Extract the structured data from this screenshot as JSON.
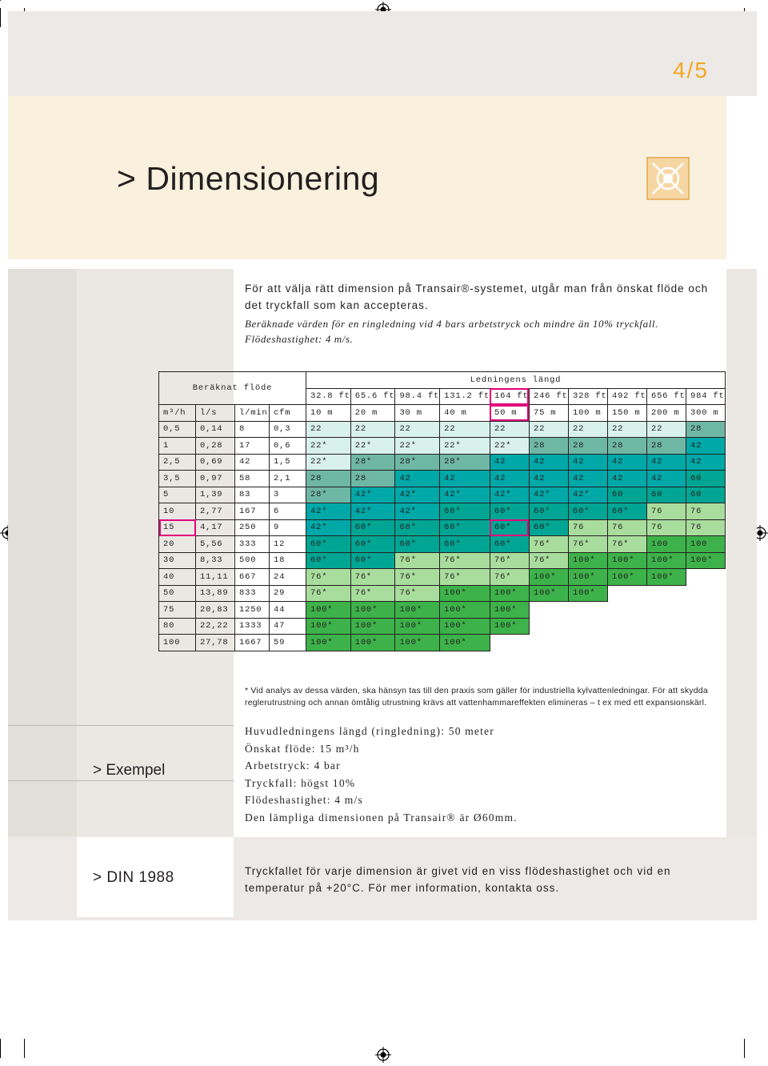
{
  "page": {
    "number": "4/5",
    "title": "> Dimensionering"
  },
  "intro": {
    "line1": "För att välja rätt dimension på Transair®-systemet, utgår man från önskat flöde och det tryckfall som kan accepteras.",
    "italic": "Beräknade värden för en ringledning      vid 4 bars arbetstryck och mindre än 10% tryckfall. Flödeshastighet: 4 m/s."
  },
  "table": {
    "flow_header": "Beräknat flöde",
    "length_header": "Ledningens längd",
    "ft_labels": [
      "32.8 ft",
      "65.6 ft",
      "98.4 ft",
      "131.2 ft",
      "164 ft",
      "246 ft",
      "328 ft",
      "492 ft",
      "656 ft",
      "984 ft"
    ],
    "unit_labels": [
      "m³/h",
      "l/s",
      "l/min",
      "cfm"
    ],
    "m_labels": [
      "10 m",
      "20 m",
      "30 m",
      "40 m",
      "50 m",
      "75 m",
      "100 m",
      "150 m",
      "200 m",
      "300 m"
    ],
    "rows": [
      {
        "flow": [
          "0,5",
          "0,14",
          "8",
          "0,3"
        ],
        "cells": [
          "22",
          "22",
          "22",
          "22",
          "22",
          "22",
          "22",
          "22",
          "22",
          "28"
        ]
      },
      {
        "flow": [
          "1",
          "0,28",
          "17",
          "0,6"
        ],
        "cells": [
          "22*",
          "22*",
          "22*",
          "22*",
          "22*",
          "28",
          "28",
          "28",
          "28",
          "42"
        ]
      },
      {
        "flow": [
          "2,5",
          "0,69",
          "42",
          "1,5"
        ],
        "cells": [
          "22*",
          "28*",
          "28*",
          "28*",
          "42",
          "42",
          "42",
          "42",
          "42",
          "42"
        ]
      },
      {
        "flow": [
          "3,5",
          "0,97",
          "58",
          "2,1"
        ],
        "cells": [
          "28",
          "28",
          "42",
          "42",
          "42",
          "42",
          "42",
          "42",
          "42",
          "60"
        ]
      },
      {
        "flow": [
          "5",
          "1,39",
          "83",
          "3"
        ],
        "cells": [
          "28*",
          "42*",
          "42*",
          "42*",
          "42*",
          "42*",
          "42*",
          "60",
          "60",
          "60"
        ]
      },
      {
        "flow": [
          "10",
          "2,77",
          "167",
          "6"
        ],
        "cells": [
          "42*",
          "42*",
          "42*",
          "60*",
          "60*",
          "60*",
          "60*",
          "60*",
          "76",
          "76"
        ]
      },
      {
        "flow": [
          "15",
          "4,17",
          "250",
          "9"
        ],
        "cells": [
          "42*",
          "60*",
          "60*",
          "60*",
          "60*",
          "60*",
          "76",
          "76",
          "76",
          "76"
        ]
      },
      {
        "flow": [
          "20",
          "5,56",
          "333",
          "12"
        ],
        "cells": [
          "60*",
          "60*",
          "60*",
          "60*",
          "60*",
          "76*",
          "76*",
          "76*",
          "100",
          "100"
        ]
      },
      {
        "flow": [
          "30",
          "8,33",
          "500",
          "18"
        ],
        "cells": [
          "60*",
          "60*",
          "76*",
          "76*",
          "76*",
          "76*",
          "100*",
          "100*",
          "100*",
          "100*"
        ]
      },
      {
        "flow": [
          "40",
          "11,11",
          "667",
          "24"
        ],
        "cells": [
          "76*",
          "76*",
          "76*",
          "76*",
          "76*",
          "100*",
          "100*",
          "100*",
          "100*",
          ""
        ]
      },
      {
        "flow": [
          "50",
          "13,89",
          "833",
          "29"
        ],
        "cells": [
          "76*",
          "76*",
          "76*",
          "100*",
          "100*",
          "100*",
          "100*",
          "",
          "",
          ""
        ]
      },
      {
        "flow": [
          "75",
          "20,83",
          "1250",
          "44"
        ],
        "cells": [
          "100*",
          "100*",
          "100*",
          "100*",
          "100*",
          "",
          "",
          "",
          "",
          ""
        ]
      },
      {
        "flow": [
          "80",
          "22,22",
          "1333",
          "47"
        ],
        "cells": [
          "100*",
          "100*",
          "100*",
          "100*",
          "100*",
          "",
          "",
          "",
          "",
          ""
        ]
      },
      {
        "flow": [
          "100",
          "27,78",
          "1667",
          "59"
        ],
        "cells": [
          "100*",
          "100*",
          "100*",
          "100*",
          "",
          "",
          "",
          "",
          "",
          ""
        ]
      }
    ],
    "colors": {
      "a": "#d9f1ec",
      "b": "#6fb7a5",
      "c": "#00a8a8",
      "d": "#00a693",
      "e": "#a9dd9d",
      "f": "#3db24a",
      "highlight": "#e2007a"
    }
  },
  "note": "* Vid analys av dessa värden, ska hänsyn tas till den praxis som gäller för industriella kylvattenledningar. För att skydda reglerutrustning och annan ömtålig utrustning krävs att vattenhammareffekten elimineras – t ex med ett expansionskärl.",
  "example": {
    "label": "> Exempel",
    "lines": [
      "Huvudledningens längd (ringledning): 50 meter",
      "Önskat flöde: 15 m³/h",
      "Arbetstryck: 4 bar",
      "Tryckfall: högst 10%",
      "Flödeshastighet: 4 m/s",
      "Den lämpliga dimensionen på Transair® är Ø60mm."
    ]
  },
  "din": {
    "label": "> DIN 1988",
    "text": "Tryckfallet för varje dimension är givet vid en viss flödeshastighet och vid en temperatur på +20°C. För mer information, kontakta oss."
  }
}
